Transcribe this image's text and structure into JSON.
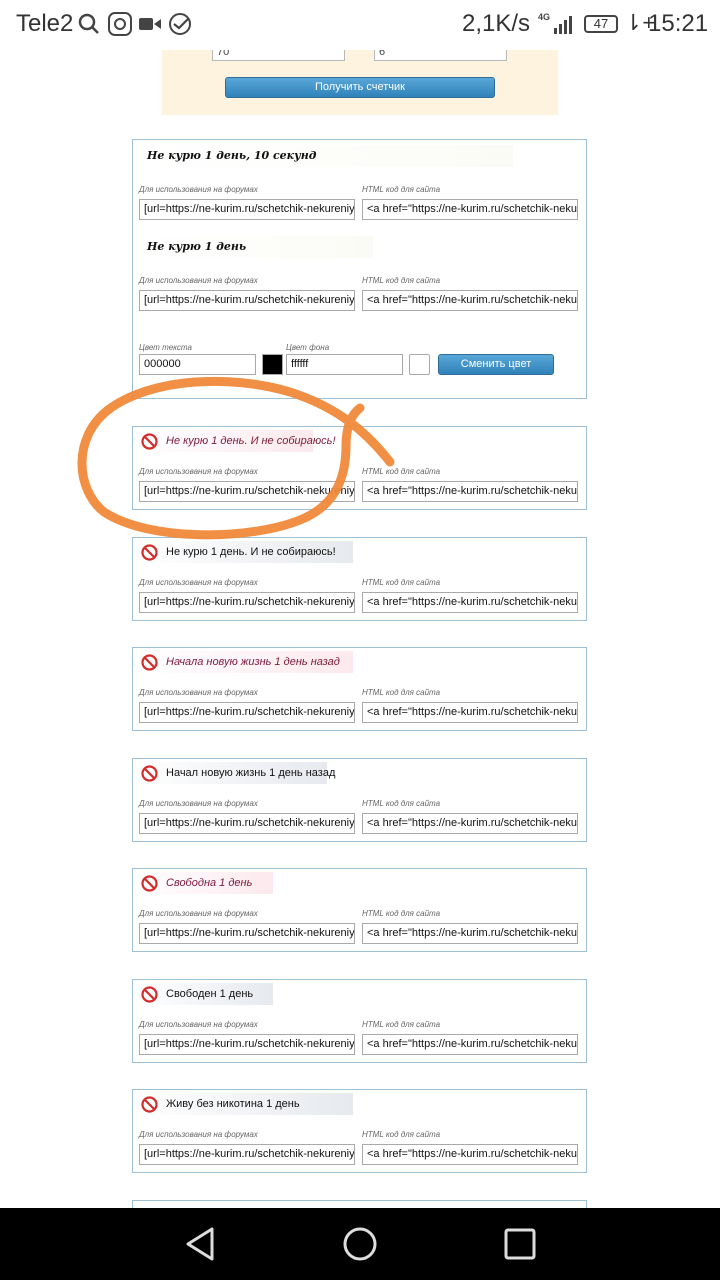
{
  "status_bar": {
    "carrier": "Tele2",
    "speed": "2,1K/s",
    "network": "4G",
    "battery": "47",
    "time": "15:21"
  },
  "top_form": {
    "field1_value": "70",
    "field2_value": "6",
    "button_label": "Получить счетчик"
  },
  "labels": {
    "forum": "Для использования на форумах",
    "html": "HTML код для сайта"
  },
  "codes": {
    "forum": "[url=https://ne-kurim.ru/schetchik-nekureniya",
    "html": "<a href=\"https://ne-kurim.ru/schetchik-nekureniya"
  },
  "color_panel": {
    "text_color_label": "Цвет текста",
    "text_color_value": "000000",
    "text_swatch": "#000000",
    "bg_color_label": "Цвет фона",
    "bg_color_value": "ffffff",
    "bg_swatch": "#ffffff",
    "change_button": "Сменить цвет"
  },
  "custom_banners": [
    "Не курю 1 день, 10 секунд",
    "Не курю 1 день"
  ],
  "counter_banners": [
    {
      "text": "Не курю 1 день. И не собираюсь!",
      "style": "pink"
    },
    {
      "text": "Не курю 1 день. И не собираюсь!",
      "style": "gray"
    },
    {
      "text": "Начала новую жизнь 1 день назад",
      "style": "pink"
    },
    {
      "text": "Начал новую жизнь 1 день назад",
      "style": "gray"
    },
    {
      "text": "Свободна 1 день",
      "style": "pink"
    },
    {
      "text": "Свободен 1 день",
      "style": "gray"
    },
    {
      "text": "Живу без никотина 1 день",
      "style": "gray"
    }
  ],
  "annotation_color": "#f0893a"
}
